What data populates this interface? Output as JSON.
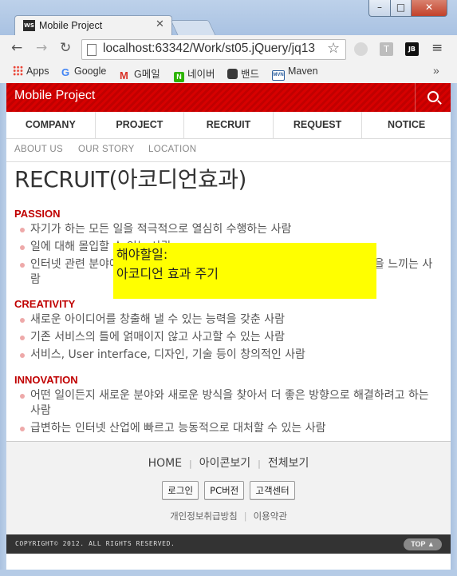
{
  "browser": {
    "tab_title": "Mobile Project",
    "tab_favicon_text": "WS",
    "url": "localhost:63342/Work/st05.jQuery/jq13",
    "bookmarks": [
      {
        "label": "Apps",
        "icon": "apps-grid-icon",
        "color": "#4285f4"
      },
      {
        "label": "Google",
        "icon": "google-icon",
        "color": "#4285f4"
      },
      {
        "label": "G메일",
        "icon": "gmail-icon",
        "color": "#d93025"
      },
      {
        "label": "네이버",
        "icon": "naver-icon",
        "color": "#2db400"
      },
      {
        "label": "밴드",
        "icon": "band-icon",
        "color": "#3a3a3a"
      },
      {
        "label": "Maven",
        "icon": "maven-icon",
        "color": "#2c5f9e"
      }
    ],
    "bookmarks_more": "»"
  },
  "site": {
    "title": "Mobile Project",
    "gnb": [
      "COMPANY",
      "PROJECT",
      "RECRUIT",
      "REQUEST",
      "NOTICE"
    ],
    "lnb": [
      "ABOUT US",
      "OUR STORY",
      "LOCATION"
    ]
  },
  "content": {
    "page_title": "RECRUIT(아코디언효과)",
    "sections": [
      {
        "heading": "PASSION",
        "items": [
          "자기가 하는 모든 일을 적극적으로 열심히 수행하는 사람",
          "일에 대해 몰입할 수 있는 사람",
          "인터넷 관련 분야에 대한 열정을 가지고 새로운 것을 만들어내는 것에 보람을 느끼는 사람"
        ]
      },
      {
        "heading": "CREATIVITY",
        "items": [
          "새로운 아이디어를 창출해 낼 수 있는 능력을 갖춘 사람",
          "기존 서비스의 틀에 얽매이지 않고 사고할 수 있는 사람",
          "서비스, User interface, 디자인, 기술 등이 창의적인 사람"
        ]
      },
      {
        "heading": "INNOVATION",
        "items": [
          "어떤 일이든지 새로운 분야와 새로운 방식을 찾아서 더 좋은 방향으로 해결하려고 하는 사람",
          "급변하는 인터넷 산업에 빠르고 능동적으로 대처할 수 있는 사람"
        ]
      }
    ],
    "note": {
      "line1": "해야할일:",
      "line2": "아코디언 효과 주기",
      "color": "#ffff00"
    }
  },
  "footer": {
    "nav": [
      "HOME",
      "아이콘보기",
      "전체보기"
    ],
    "buttons": [
      "로그인",
      "PC버전",
      "고객센터"
    ],
    "links": [
      "개인정보취급방침",
      "이용약관"
    ],
    "copyright": "COPYRIGHT© 2012. ALL RIGHTS RESERVED.",
    "top_label": "TOP ▲"
  },
  "colors": {
    "brand_red": "#d70000",
    "section_heading": "#c00000",
    "bullet": "#eea9a9"
  }
}
